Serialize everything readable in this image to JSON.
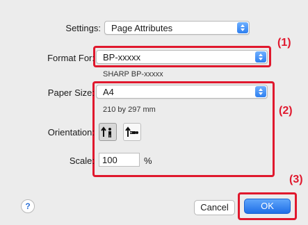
{
  "settings": {
    "label": "Settings:",
    "value": "Page Attributes"
  },
  "format_for": {
    "label": "Format For:",
    "value": "BP-xxxxx",
    "subtitle": "SHARP BP-xxxxx"
  },
  "paper_size": {
    "label": "Paper Size:",
    "value": "A4",
    "dimensions": "210 by 297 mm"
  },
  "orientation": {
    "label": "Orientation:",
    "options": [
      "portrait",
      "landscape"
    ],
    "selected": "portrait"
  },
  "scale": {
    "label": "Scale:",
    "value": "100",
    "unit": "%"
  },
  "buttons": {
    "help": "?",
    "cancel": "Cancel",
    "ok": "OK"
  },
  "callouts": {
    "c1": "(1)",
    "c2": "(2)",
    "c3": "(3)"
  },
  "colors": {
    "accent_blue": "#2e7ff0",
    "callout_red": "#e0182d",
    "background": "#ececec"
  },
  "icons": [
    "stepper-icon",
    "portrait-orientation-icon",
    "landscape-orientation-icon",
    "help-icon"
  ]
}
